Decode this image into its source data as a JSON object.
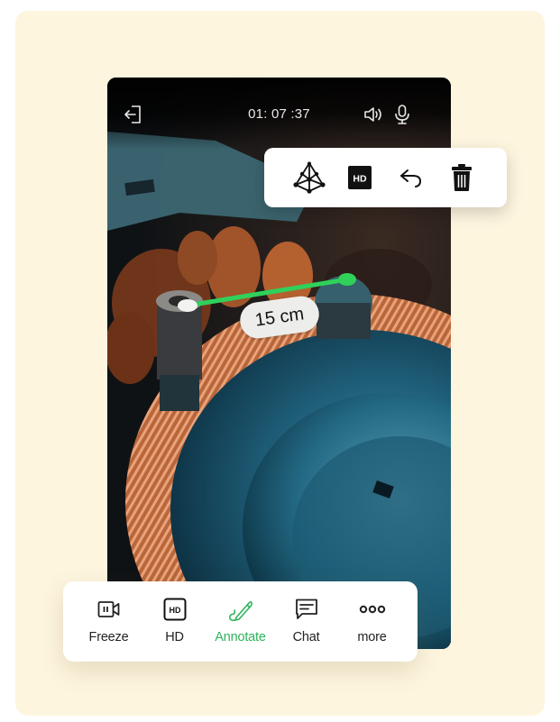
{
  "call": {
    "timer": "01: 07 :37",
    "top_icons": {
      "exit": "exit-icon",
      "speaker": "speaker-icon",
      "mic": "microphone-icon"
    }
  },
  "tool_popup": {
    "items": [
      {
        "name": "3d-ar-icon",
        "label": "AR 3D"
      },
      {
        "name": "hd-icon",
        "label": "HD"
      },
      {
        "name": "undo-icon",
        "label": "Undo"
      },
      {
        "name": "trash-icon",
        "label": "Delete"
      }
    ],
    "hd_text": "HD"
  },
  "measurement": {
    "value": 15,
    "unit": "cm",
    "label": "15 cm",
    "line_color": "#2fd15a"
  },
  "bottom_bar": {
    "items": [
      {
        "label": "Freeze",
        "icon": "freeze-video-icon",
        "active": false
      },
      {
        "label": "HD",
        "icon": "hd-icon",
        "active": false
      },
      {
        "label": "Annotate",
        "icon": "pen-icon",
        "active": true
      },
      {
        "label": "Chat",
        "icon": "chat-icon",
        "active": false
      },
      {
        "label": "more",
        "icon": "more-icon",
        "active": false
      }
    ],
    "hd_text": "HD"
  },
  "colors": {
    "background": "#fdf5de",
    "accent": "#2fb35c",
    "measure_line": "#2fd15a"
  }
}
